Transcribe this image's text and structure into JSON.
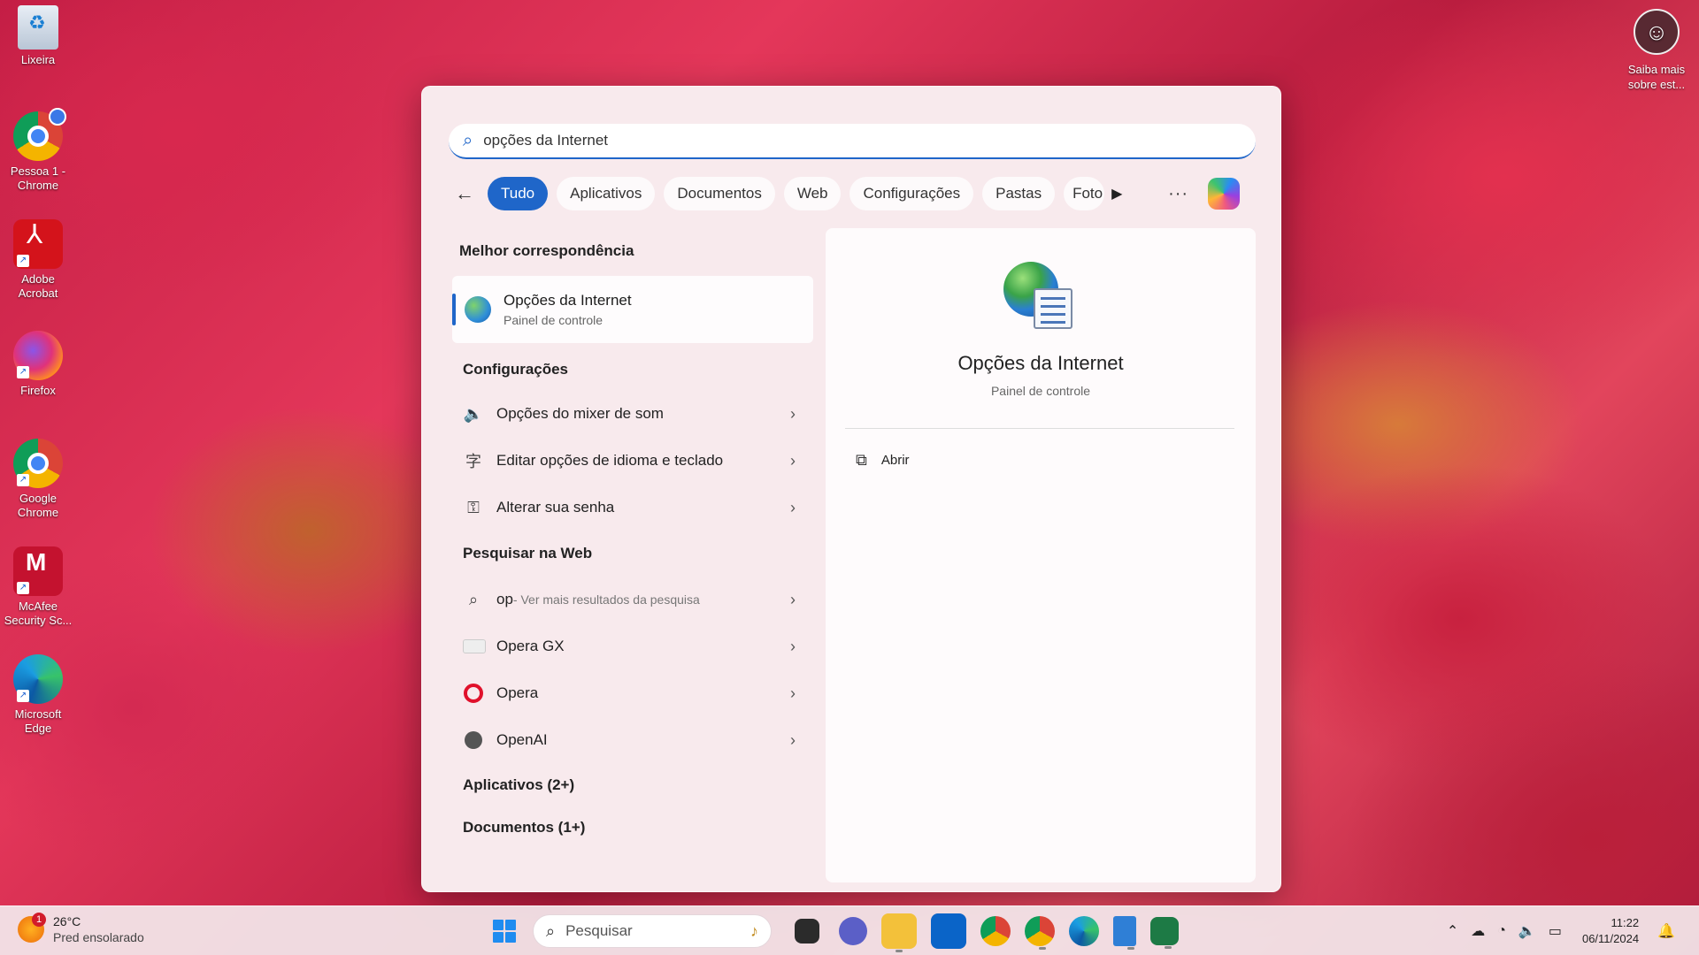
{
  "desktop": {
    "icons": [
      {
        "label": "Lixeira",
        "icon": "recycle-bin-icon"
      },
      {
        "label": "Pessoa 1 - Chrome",
        "icon": "chrome-profile-icon"
      },
      {
        "label": "Adobe Acrobat",
        "icon": "adobe-acrobat-icon"
      },
      {
        "label": "Firefox",
        "icon": "firefox-icon"
      },
      {
        "label": "Google Chrome",
        "icon": "chrome-icon"
      },
      {
        "label": "McAfee Security Sc...",
        "icon": "mcafee-icon"
      },
      {
        "label": "Microsoft Edge",
        "icon": "edge-icon"
      }
    ],
    "tip_widget": {
      "line1": "Saiba mais",
      "line2": "sobre est..."
    }
  },
  "search": {
    "query": "opções da Internet",
    "filters": [
      "Tudo",
      "Aplicativos",
      "Documentos",
      "Web",
      "Configurações",
      "Pastas",
      "Foto"
    ],
    "active_filter": "Tudo",
    "more_label": "···"
  },
  "results": {
    "best_match_title": "Melhor correspondência",
    "best_match": {
      "title": "Opções da Internet",
      "subtitle": "Painel de controle"
    },
    "settings_title": "Configurações",
    "settings_items": [
      {
        "label": "Opções do mixer de som",
        "icon": "speaker-icon"
      },
      {
        "label": "Editar opções de idioma e teclado",
        "icon": "language-icon"
      },
      {
        "label": "Alterar sua senha",
        "icon": "key-icon"
      }
    ],
    "web_title": "Pesquisar na Web",
    "web_query": "op",
    "web_hint": " - Ver mais resultados da pesquisa",
    "web_items": [
      {
        "label": "Opera GX",
        "icon": "opera-gx-icon"
      },
      {
        "label": "Opera",
        "icon": "opera-icon"
      },
      {
        "label": "OpenAI",
        "icon": "openai-icon"
      }
    ],
    "apps_title": "Aplicativos (2+)",
    "docs_title": "Documentos (1+)"
  },
  "preview": {
    "title": "Opções da Internet",
    "subtitle": "Painel de controle",
    "action": "Abrir"
  },
  "taskbar": {
    "weather": {
      "badge": "1",
      "temp": "26°C",
      "condition": "Pred ensolarado"
    },
    "search_placeholder": "Pesquisar",
    "clock": {
      "time": "11:22",
      "date": "06/11/2024"
    }
  }
}
